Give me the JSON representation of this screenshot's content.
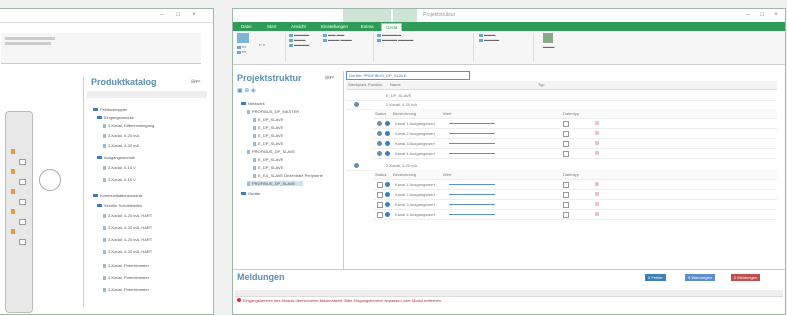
{
  "window_left": {
    "panel_title": "Produktkatalog",
    "tree_items": [
      "Feldbuskoppler",
      "Eingangsmodule",
      "2-Kanal, Differenzeingang",
      "2-Kanal, 0-20 mA",
      "2-Kanal, 4-20 mA",
      "Ausgangsmodule",
      "2-Kanal, 0-10 V",
      "2-Kanal, 0-10 V",
      "Kommunikationsmodule",
      "Serielle Schnittstellen",
      "2-Kanal, 4-20 mA, HART",
      "2-Kanal, 4-20 mA, HART",
      "2-Kanal, 4-20 mA, HART",
      "2-Kanal, 4-20 mA, HART",
      "2-Kanal, Potentiometer",
      "2-Kanal, Potentiometer",
      "2-Kanal, Potentiometer"
    ]
  },
  "window_right": {
    "title": "Projektstruktur",
    "ribbon_tabs": [
      "Datei",
      "Start",
      "Ansicht",
      "Einstellungen",
      "Extras",
      "Gerät"
    ],
    "panel_title": "Projektstruktur",
    "doc_tab": "Geräte: PROFIBUS_DP_SLAVE",
    "column_headers": [
      "Steckplatz",
      "Position",
      "Name",
      "Typ"
    ],
    "sub_headers": [
      "Status",
      "Bezeichnung",
      "Wert",
      "Datentyp"
    ],
    "tree_items": [
      "Netzwerk",
      "PROFIBUS_DP_MASTER",
      "E_DP_SLAVE",
      "E_DP_SLAVE",
      "E_DP_SLAVE",
      "E_DP_SLAVE",
      "PROFIBUS_DP_SLAVE",
      "E_DP_SLAVE",
      "E_DP_SLAVE",
      "E_EA_SLAVE Dezentrale Peripherie",
      "PROFIBUS_DP_SLAVE",
      "Geräte"
    ],
    "module_rows": [
      "E_DP_SLAVE",
      "2-Kanal, 4-20 mA",
      "2-Kanal, 4-20 mA"
    ],
    "channels": [
      "Kanal 1 Ausgangswert",
      "Kanal 2 Ausgangswert",
      "Kanal 3 Ausgangswert",
      "Kanal 4 Ausgangswert"
    ],
    "bottom_title": "Meldungen",
    "bottom_buttons": [
      "0 Fehler",
      "0 Warnungen",
      "0 Meldungen"
    ],
    "message": "Eingangsbereich des Moduls überschreitet Maximalwert. Bitte Eingangsbereich anpassen oder Modul entfernen."
  }
}
